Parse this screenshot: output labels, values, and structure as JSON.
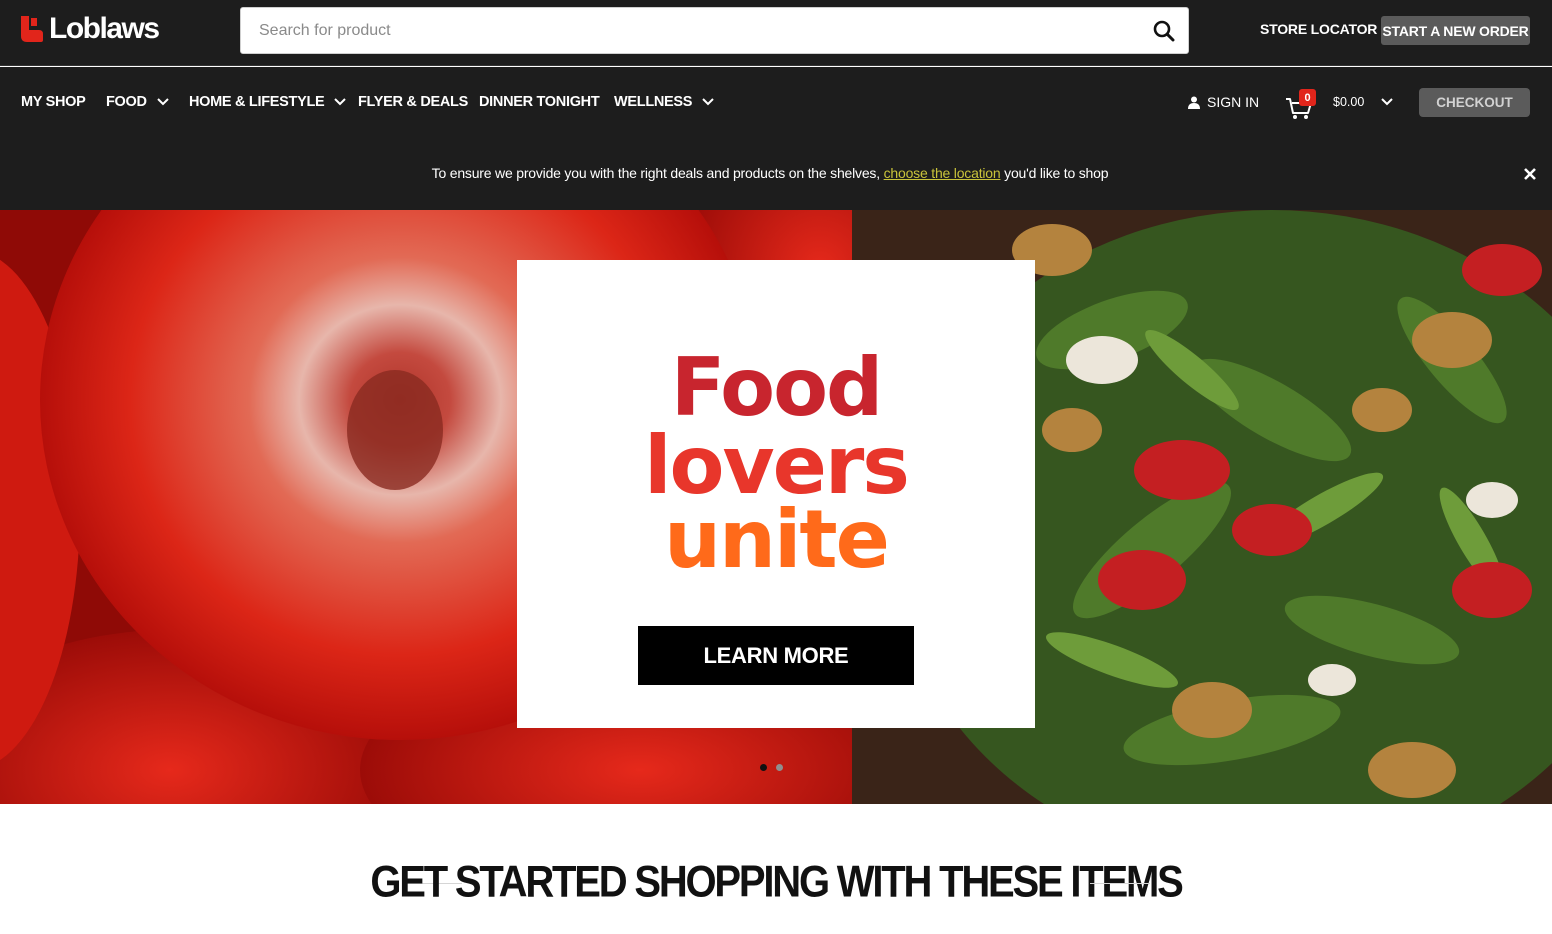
{
  "brand": {
    "name": "Loblaws",
    "accent": "#e1251b"
  },
  "search": {
    "placeholder": "Search for product",
    "value": ""
  },
  "header_links": {
    "store_locator": "STORE LOCATOR",
    "new_order": "START A NEW ORDER"
  },
  "nav": {
    "items": [
      {
        "label": "MY SHOP",
        "has_dropdown": false
      },
      {
        "label": "FOOD",
        "has_dropdown": true
      },
      {
        "label": "HOME & LIFESTYLE",
        "has_dropdown": true
      },
      {
        "label": "FLYER & DEALS",
        "has_dropdown": false
      },
      {
        "label": "DINNER TONIGHT",
        "has_dropdown": false
      },
      {
        "label": "WELLNESS",
        "has_dropdown": true
      }
    ],
    "sign_in": "SIGN IN",
    "cart_count": "0",
    "cart_total": "$0.00",
    "checkout": "CHECKOUT"
  },
  "notice": {
    "before": "To ensure we provide you with the right deals and products on the shelves, ",
    "link": "choose the location",
    "after": " you'd like to shop"
  },
  "hero": {
    "headline": [
      "Food",
      "lovers",
      "unite"
    ],
    "headline_colors": [
      "#c8252e",
      "#e8362b",
      "#ff6a1a"
    ],
    "cta": "LEARN MORE",
    "slide_count": 2,
    "active_slide": 1
  },
  "section": {
    "title": "GET STARTED SHOPPING WITH THESE ITEMS"
  }
}
